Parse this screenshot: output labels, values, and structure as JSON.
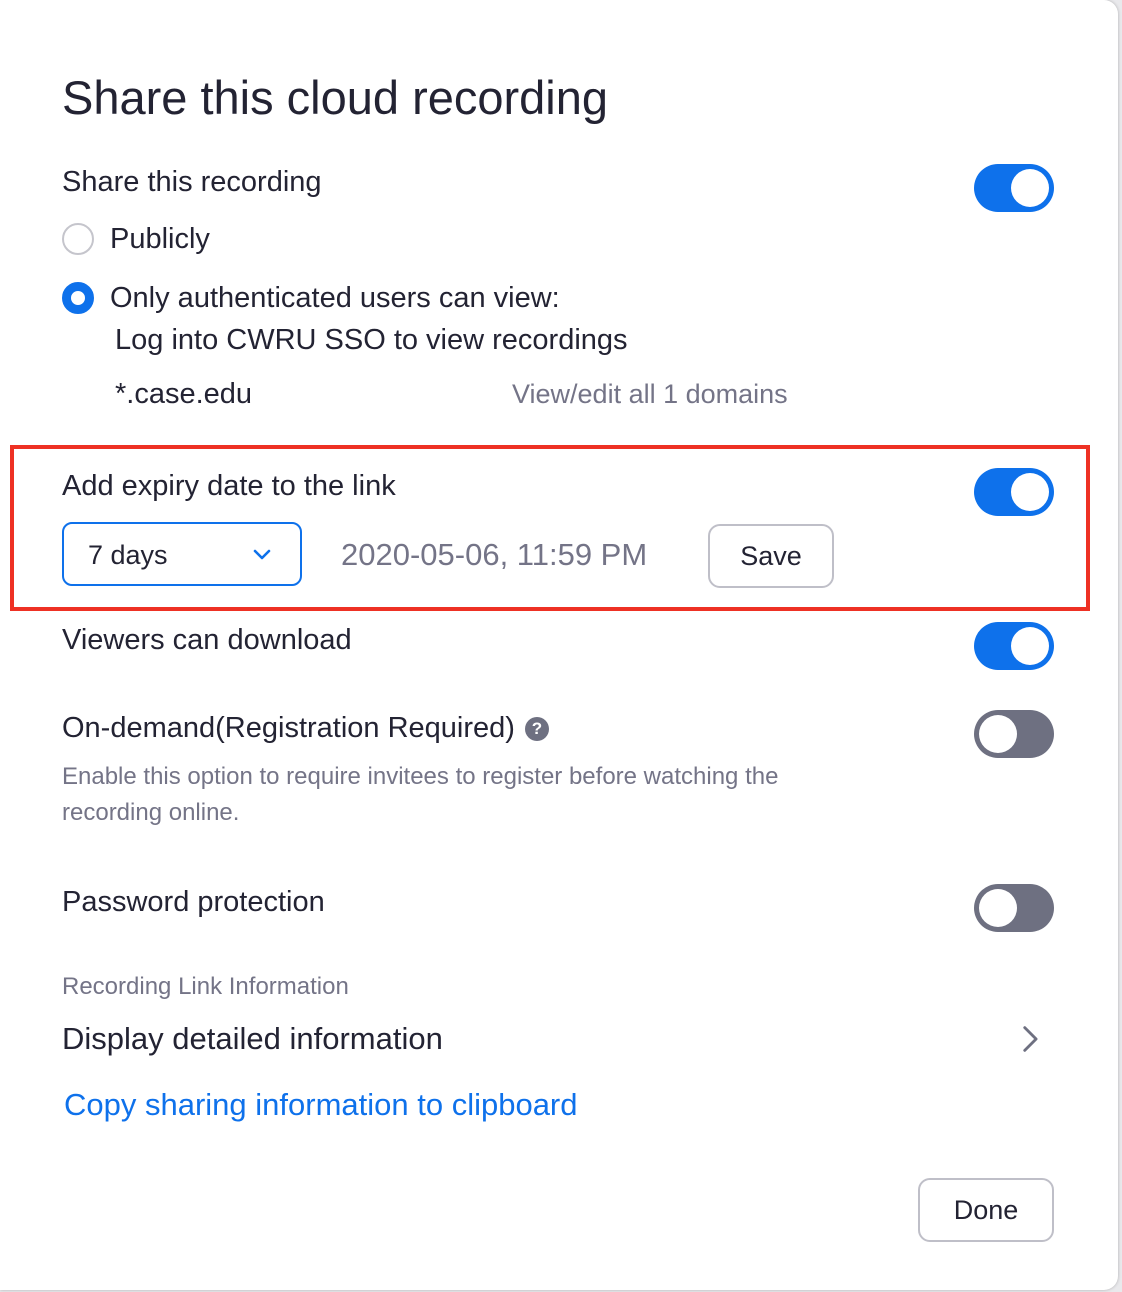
{
  "dialog": {
    "title": "Share this cloud recording"
  },
  "share": {
    "label": "Share this recording",
    "enabled": true,
    "option_public": "Publicly",
    "option_auth": "Only authenticated users can view:",
    "auth_detail": "Log into CWRU SSO to view recordings",
    "domain": "*.case.edu",
    "domains_link": "View/edit all 1 domains"
  },
  "expiry": {
    "label": "Add expiry date to the link",
    "enabled": true,
    "duration": "7 days",
    "date": "2020-05-06, 11:59 PM",
    "save_label": "Save"
  },
  "download": {
    "label": "Viewers can download",
    "enabled": true
  },
  "on_demand": {
    "label": "On-demand(Registration Required)",
    "help_glyph": "?",
    "description": "Enable this option to require invitees to register before watching the recording online.",
    "enabled": false
  },
  "password": {
    "label": "Password protection",
    "enabled": false
  },
  "link_info": {
    "section_label": "Recording Link Information",
    "display_label": "Display detailed information",
    "copy_label": "Copy sharing information to clipboard"
  },
  "footer": {
    "done_label": "Done"
  },
  "colors": {
    "accent": "#0e71eb",
    "toggle_off": "#6e7081",
    "highlight": "#ee3124"
  }
}
